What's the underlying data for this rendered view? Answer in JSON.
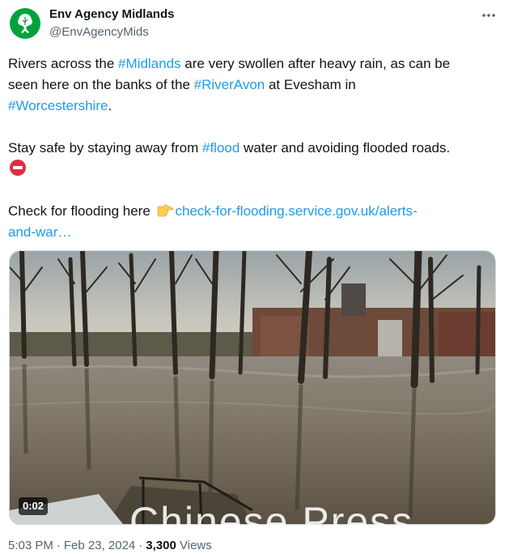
{
  "author": {
    "display_name": "Env Agency Midlands",
    "handle": "@EnvAgencyMids",
    "avatar_icon": "tree-logo-icon",
    "avatar_color": "#00A33B"
  },
  "more_icon": "more-options-icon",
  "tweet": {
    "line1_a": "Rivers across the ",
    "line1_tag": "#Midlands",
    "line1_b": " are very swollen after heavy rain, as can be",
    "line2_a": "seen here on the banks of the ",
    "line2_tag": "#RiverAvon",
    "line2_b": " at Evesham in",
    "line3_tag": "#Worcestershire",
    "line3_b": ".",
    "line4_a": "Stay safe by staying away from ",
    "line4_tag": "#flood",
    "line4_b": " water and avoiding flooded roads.",
    "line5_icon": "no-entry-emoji",
    "line6_a": "Check for flooding here ",
    "line6_icon": "pointing-right-emoji",
    "line6_link": "check-for-flooding.service.gov.uk/alerts-",
    "line7_link": "and-war…"
  },
  "media": {
    "type": "video",
    "duration": "0:02",
    "scene": "flooded-riverbank-video"
  },
  "watermark": "Chinese Press",
  "meta": {
    "time": "5:03 PM",
    "separator": "·",
    "date": "Feb 23, 2024",
    "views_count": "3,300",
    "views_label": "Views"
  },
  "colors": {
    "link": "#1d9bf0",
    "text": "#0f1419",
    "secondary": "#536471"
  }
}
